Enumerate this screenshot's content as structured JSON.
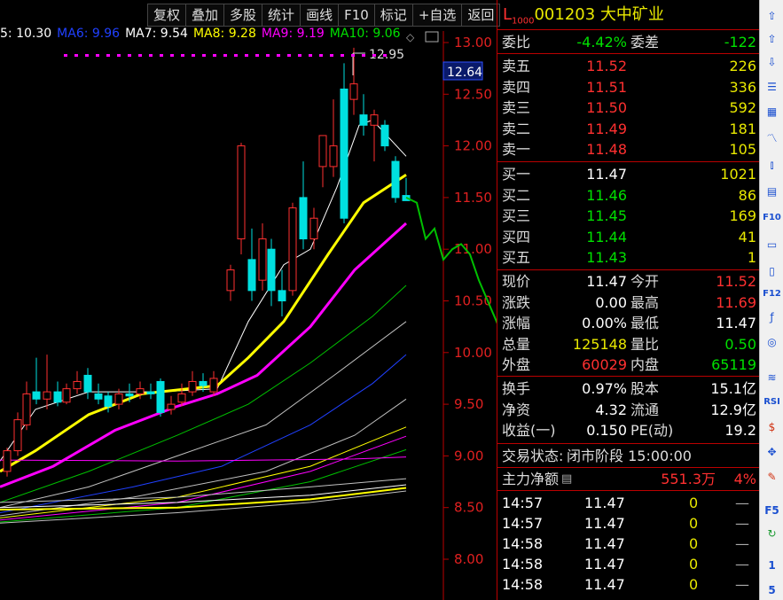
{
  "toolbar": {
    "buttons": [
      "复权",
      "叠加",
      "多股",
      "统计",
      "画线",
      "F10",
      "标记",
      "+自选",
      "返回"
    ]
  },
  "ma_legend": [
    {
      "label": "5: 10.30",
      "color": "#ffffff"
    },
    {
      "label": "MA6: 9.96",
      "color": "#2040ff"
    },
    {
      "label": "MA7: 9.54",
      "color": "#ffffff"
    },
    {
      "label": "MA8: 9.28",
      "color": "#ffff00"
    },
    {
      "label": "MA9: 9.19",
      "color": "#ff00ff"
    },
    {
      "label": "MA10: 9.06",
      "color": "#00e000"
    }
  ],
  "price_axis": {
    "ticks": [
      "13.00",
      "12.50",
      "12.00",
      "11.50",
      "11.00",
      "10.50",
      "10.00",
      "9.50",
      "9.00",
      "8.50",
      "8.00"
    ],
    "current_price_tag": "12.64",
    "high_marker": "12.95"
  },
  "quote_panel": {
    "title_prefix": "L",
    "title_sub": "1000",
    "code": "001203",
    "name": "大中矿业",
    "weibi_label": "委比",
    "weibi_value": "-4.42%",
    "weicha_label": "委差",
    "weicha_value": "-122",
    "sells": [
      {
        "label": "卖五",
        "price": "11.52",
        "vol": "226"
      },
      {
        "label": "卖四",
        "price": "11.51",
        "vol": "336"
      },
      {
        "label": "卖三",
        "price": "11.50",
        "vol": "592"
      },
      {
        "label": "卖二",
        "price": "11.49",
        "vol": "181"
      },
      {
        "label": "卖一",
        "price": "11.48",
        "vol": "105"
      }
    ],
    "buys": [
      {
        "label": "买一",
        "price": "11.47",
        "vol": "1021"
      },
      {
        "label": "买二",
        "price": "11.46",
        "vol": "86"
      },
      {
        "label": "买三",
        "price": "11.45",
        "vol": "169"
      },
      {
        "label": "买四",
        "price": "11.44",
        "vol": "41"
      },
      {
        "label": "买五",
        "price": "11.43",
        "vol": "1"
      }
    ],
    "stats": [
      {
        "l1": "现价",
        "v1": "11.47",
        "c1": "white",
        "l2": "今开",
        "v2": "11.52",
        "c2": "red"
      },
      {
        "l1": "涨跌",
        "v1": "0.00",
        "c1": "white",
        "l2": "最高",
        "v2": "11.69",
        "c2": "red"
      },
      {
        "l1": "涨幅",
        "v1": "0.00%",
        "c1": "white",
        "l2": "最低",
        "v2": "11.47",
        "c2": "white"
      },
      {
        "l1": "总量",
        "v1": "125148",
        "c1": "yellow",
        "l2": "量比",
        "v2": "0.50",
        "c2": "green"
      },
      {
        "l1": "外盘",
        "v1": "60029",
        "c1": "red",
        "l2": "内盘",
        "v2": "65119",
        "c2": "green"
      }
    ],
    "stats2": [
      {
        "l1": "换手",
        "v1": "0.97%",
        "l2": "股本",
        "v2": "15.1亿"
      },
      {
        "l1": "净资",
        "v1": "4.32",
        "l2": "流通",
        "v2": "12.9亿"
      },
      {
        "l1": "收益(一)",
        "v1": "0.150",
        "l2": "PE(动)",
        "v2": "19.2"
      }
    ],
    "status_label": "交易状态:",
    "status_value": "闭市阶段 15:00:00",
    "main_flow_label": "主力净额",
    "main_flow_value": "551.3万",
    "main_flow_pct": "4%",
    "trades": [
      {
        "time": "14:57",
        "price": "11.47",
        "vol": "0",
        "dir": "—"
      },
      {
        "time": "14:57",
        "price": "11.47",
        "vol": "0",
        "dir": "—"
      },
      {
        "time": "14:58",
        "price": "11.47",
        "vol": "0",
        "dir": "—"
      },
      {
        "time": "14:58",
        "price": "11.47",
        "vol": "0",
        "dir": "—"
      },
      {
        "time": "14:58",
        "price": "11.47",
        "vol": "0",
        "dir": "—"
      }
    ]
  },
  "side_tools": [
    "up-arrow-outline-icon",
    "up-arrow-icon",
    "down-arrow-icon",
    "list-icon",
    "table-icon",
    "line-chart-icon",
    "candle-icon",
    "doc-icon",
    "F10",
    "text-icon",
    "book-icon",
    "F12",
    "f-icon",
    "circle-icon",
    "wave-icon",
    "RSI",
    "dollar-icon",
    "move-icon",
    "pencil-icon",
    "F5",
    "refresh-icon",
    "1",
    "5"
  ],
  "colors": {
    "up": "#ff3030",
    "down": "#00e0e0",
    "bg": "#000000",
    "grid": "#b00000"
  }
}
